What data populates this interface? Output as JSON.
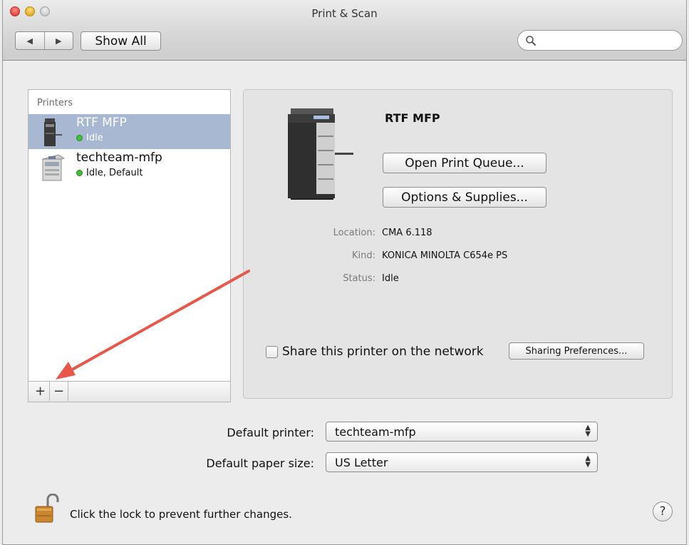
{
  "window": {
    "title": "Print & Scan"
  },
  "toolbar": {
    "back_glyph": "◀",
    "forward_glyph": "▶",
    "show_all_label": "Show All",
    "search_value": "",
    "search_placeholder": ""
  },
  "printers": {
    "header": "Printers",
    "items": [
      {
        "name": "RTF MFP",
        "status": "Idle",
        "selected": true
      },
      {
        "name": "techteam-mfp",
        "status": "Idle, Default",
        "selected": false
      }
    ],
    "add_label": "+",
    "remove_label": "−"
  },
  "detail": {
    "printer_name": "RTF MFP",
    "open_queue_label": "Open Print Queue...",
    "options_supplies_label": "Options & Supplies...",
    "location_label": "Location:",
    "location_value": "CMA 6.118",
    "kind_label": "Kind:",
    "kind_value": "KONICA MINOLTA C654e PS",
    "status_label": "Status:",
    "status_value": "Idle",
    "share_label": "Share this printer on the network",
    "share_checked": false,
    "sharing_prefs_label": "Sharing Preferences..."
  },
  "defaults": {
    "printer_label": "Default printer:",
    "printer_value": "techteam-mfp",
    "paper_label": "Default paper size:",
    "paper_value": "US Letter"
  },
  "footer": {
    "lock_text": "Click the lock to prevent further changes.",
    "help_glyph": "?"
  },
  "colors": {
    "selection": "#a8b7d2",
    "status_dot": "#3fbf36",
    "annotation_arrow": "#e8574a"
  }
}
